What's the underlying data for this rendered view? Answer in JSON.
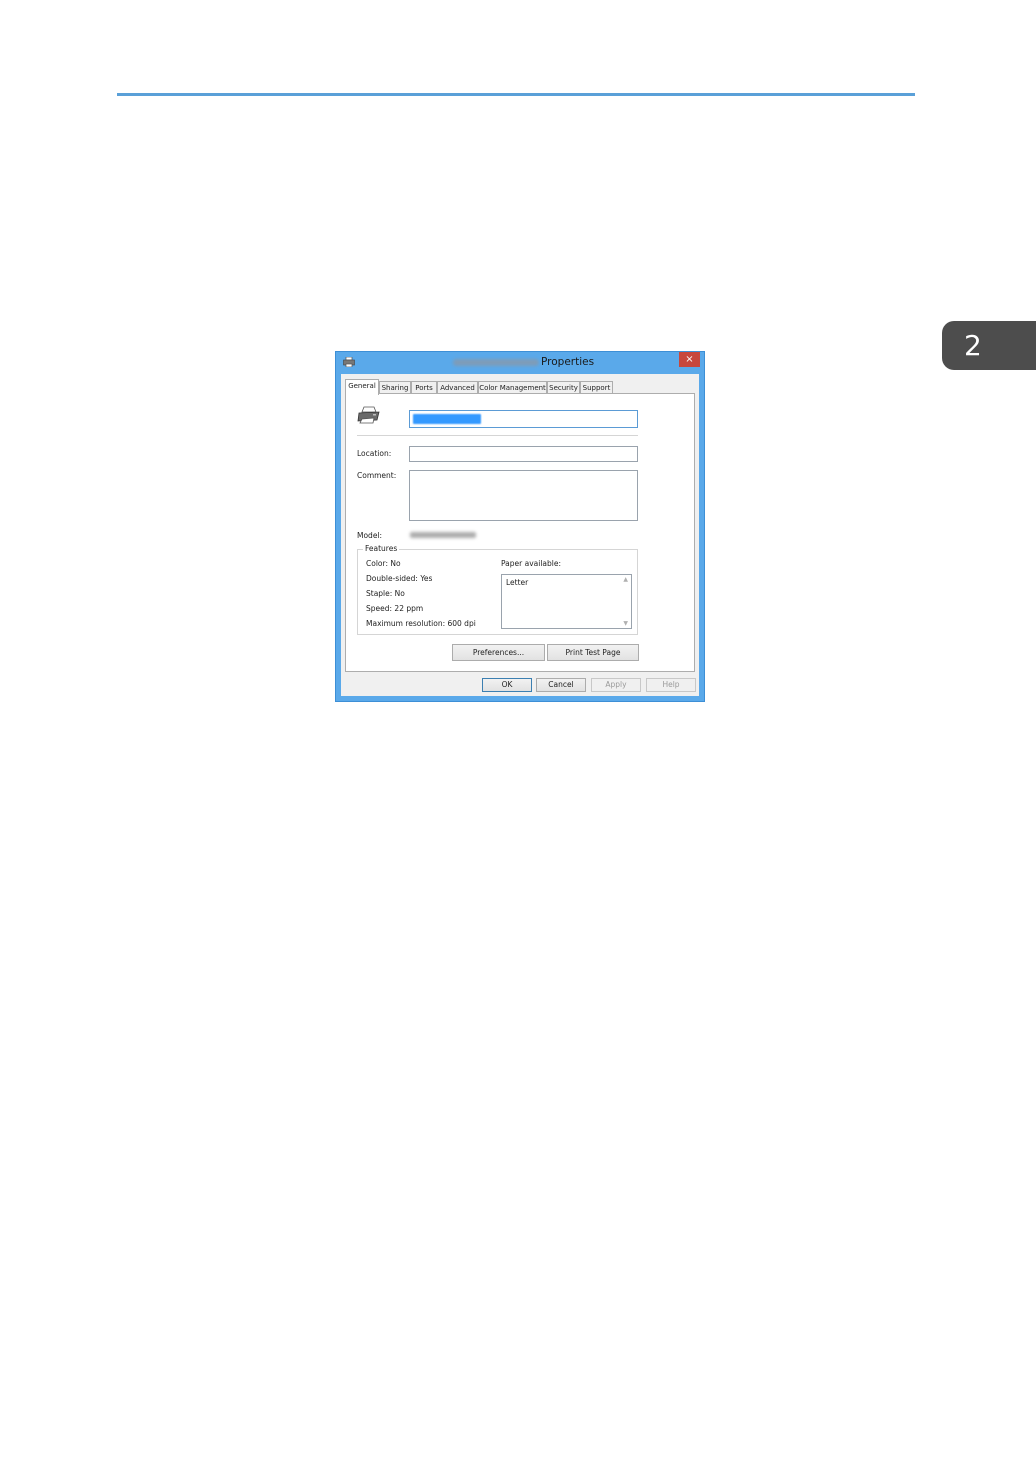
{
  "page": {
    "chapter_number": "2",
    "accent_color": "#5aa0d8",
    "chapter_tab_color": "#4d4d4d"
  },
  "dialog": {
    "title": "Properties",
    "close_glyph": "×",
    "close_color": "#c7473d",
    "titlebar_color": "#5aa9ea",
    "tabs": [
      "General",
      "Sharing",
      "Ports",
      "Advanced",
      "Color Management",
      "Security",
      "Support"
    ],
    "active_tab": "General",
    "location_label": "Location:",
    "location_value": "",
    "comment_label": "Comment:",
    "comment_value": "",
    "model_label": "Model:",
    "features": {
      "legend": "Features",
      "color": "Color: No",
      "double_sided": "Double-sided: Yes",
      "staple": "Staple: No",
      "speed": "Speed: 22 ppm",
      "max_resolution": "Maximum resolution: 600 dpi",
      "paper_available_label": "Paper available:",
      "paper_items": [
        "Letter"
      ]
    },
    "buttons": {
      "preferences": "Preferences...",
      "print_test_page": "Print Test Page",
      "ok": "OK",
      "cancel": "Cancel",
      "apply": "Apply",
      "help": "Help"
    },
    "icons": {
      "title_icon": "printer-icon",
      "printer_icon": "printer-icon"
    }
  }
}
